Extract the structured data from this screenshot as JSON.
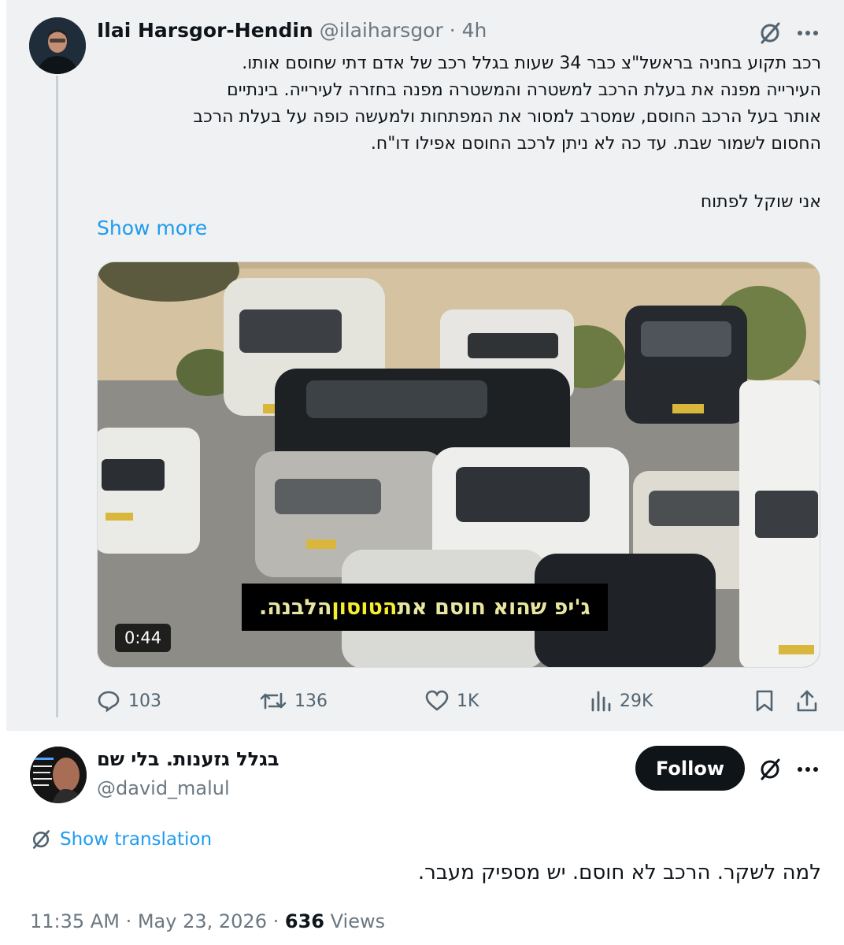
{
  "parent_tweet": {
    "author_name": "Ilai Harsgor-Hendin",
    "handle": "@ilaiharsgor",
    "separator": "·",
    "time": "4h",
    "text_lines": [
      "רכב תקוע בחניה בראשל\"צ כבר 34 שעות בגלל רכב של אדם דתי שחוסם אותו.",
      "העירייה מפנה את בעלת הרכב למשטרה והמשטרה מפנה בחזרה לעירייה. בינתיים",
      "אותר בעל הרכב החוסם, שמסרב למסור את המפתחות ולמעשה כופה על בעלת הרכב",
      "החסום לשמור שבת. עד כה לא ניתן לרכב החוסם אפילו דו\"ח."
    ],
    "text_last": "אני שוקל לפתוח",
    "show_more": "Show more",
    "video": {
      "subtitle_before": "ג'יפ שהוא חוסם את ",
      "subtitle_highlight": "הטוסון",
      "subtitle_after": " הלבנה.",
      "duration": "0:44"
    },
    "stats": {
      "replies": "103",
      "reposts": "136",
      "likes": "1K",
      "views": "29K"
    }
  },
  "reply_tweet": {
    "author_name": "בגלל גזענות. בלי שם",
    "handle": "@david_malul",
    "follow_label": "Follow",
    "show_translation": "Show translation",
    "text": "למה לשקר. הרכב לא חוסם. יש מספיק מעבר.",
    "time": "11:35 AM",
    "date": "May 23, 2026",
    "views_count": "636",
    "views_label": "Views",
    "separator": "·"
  }
}
